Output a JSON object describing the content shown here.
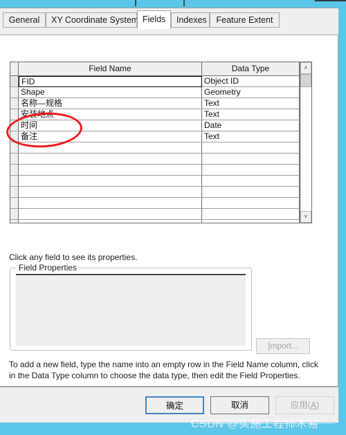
{
  "window": {
    "accent_color": "#5bc6e8",
    "dialog_bg": "#efefef"
  },
  "tabs": [
    {
      "label": "General",
      "selected": false
    },
    {
      "label": "XY Coordinate System",
      "selected": false
    },
    {
      "label": "Fields",
      "selected": true
    },
    {
      "label": "Indexes",
      "selected": false
    },
    {
      "label": "Feature Extent",
      "selected": false
    }
  ],
  "grid": {
    "columns": [
      "Field Name",
      "Data Type"
    ],
    "rows": [
      {
        "name": "FID",
        "type": "Object ID",
        "focused": true
      },
      {
        "name": "Shape",
        "type": "Geometry",
        "focused": false
      },
      {
        "name": "名称—规格",
        "type": "Text",
        "focused": false
      },
      {
        "name": "安装地点",
        "type": "Text",
        "focused": false
      },
      {
        "name": "时间",
        "type": "Date",
        "focused": false
      },
      {
        "name": "备注",
        "type": "Text",
        "focused": false
      },
      {
        "name": "",
        "type": "",
        "focused": false
      },
      {
        "name": "",
        "type": "",
        "focused": false
      },
      {
        "name": "",
        "type": "",
        "focused": false
      },
      {
        "name": "",
        "type": "",
        "focused": false
      },
      {
        "name": "",
        "type": "",
        "focused": false
      },
      {
        "name": "",
        "type": "",
        "focused": false
      },
      {
        "name": "",
        "type": "",
        "focused": false
      },
      {
        "name": "",
        "type": "",
        "focused": false
      }
    ],
    "scrollbar": {
      "up_arrow": "˄",
      "down_arrow": "˅"
    }
  },
  "annotation": {
    "shape": "ellipse",
    "color": "#ee1b1b",
    "targets_row_label": "名称—规格"
  },
  "hints": {
    "click_field": "Click any field to see its properties.",
    "add_field_line1": "To add a new field, type the name into an empty row in the Field Name column, click in",
    "add_field_line2": "the Data Type column to choose the data type, then edit the Field Properties."
  },
  "field_properties": {
    "legend": "Field Properties",
    "import_label": "Import...",
    "import_label_prefix": "I",
    "import_label_rest": "mport..."
  },
  "buttons": {
    "ok": "确定",
    "cancel": "取消",
    "apply_prefix": "应用(",
    "apply_key": "A",
    "apply_suffix": ")"
  },
  "watermark": {
    "text": "CSDN @实施工程师木易"
  }
}
